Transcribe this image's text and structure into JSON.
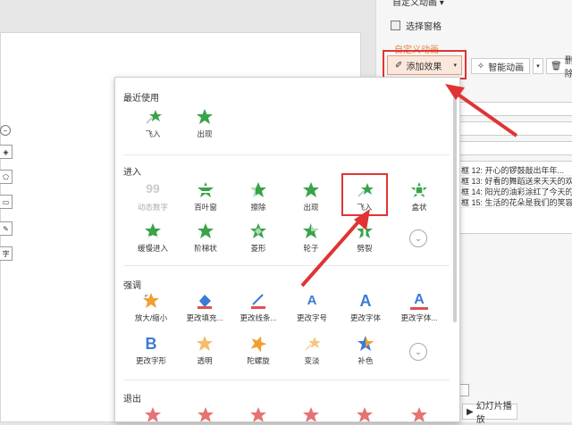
{
  "pane": {
    "title": "自定义动画",
    "selection_pane": "选择窗格",
    "custom_animation": "自定义动画",
    "add_effect": "添加效果",
    "smart_animation": "智能动画",
    "delete": "删除",
    "animation_list": [
      "框 12: 开心的锣鼓敲出年年...",
      "框 13: 好看的舞蹈送来天天的欢",
      "框 14: 阳光的油彩涂红了今天的",
      "框 15: 生活的花朵是我们的笑容"
    ],
    "slideshow": "幻灯片播放"
  },
  "left_toolbar": {
    "text_tool": "字"
  },
  "popup": {
    "recent": {
      "title": "最近使用",
      "items": [
        {
          "label": "飞入",
          "icon": "fly-in-star-icon"
        },
        {
          "label": "出现",
          "icon": "appear-star-icon"
        }
      ]
    },
    "entrance": {
      "title": "进入",
      "items": [
        {
          "label": "动态数字",
          "icon": "dynamic-number-icon",
          "glyph": "99"
        },
        {
          "label": "百叶窗",
          "icon": "blinds-star-icon"
        },
        {
          "label": "擦除",
          "icon": "wipe-star-icon"
        },
        {
          "label": "出现",
          "icon": "appear-star-icon"
        },
        {
          "label": "飞入",
          "icon": "fly-in-star-icon"
        },
        {
          "label": "盒状",
          "icon": "box-star-icon"
        },
        {
          "label": "缓慢进入",
          "icon": "crawl-in-star-icon"
        },
        {
          "label": "阶梯状",
          "icon": "stairs-star-icon"
        },
        {
          "label": "菱形",
          "icon": "diamond-star-icon"
        },
        {
          "label": "轮子",
          "icon": "wheel-star-icon"
        },
        {
          "label": "劈裂",
          "icon": "split-star-icon"
        }
      ]
    },
    "emphasis": {
      "title": "强调",
      "items": [
        {
          "label": "放大/缩小",
          "icon": "grow-shrink-star-icon"
        },
        {
          "label": "更改填充...",
          "icon": "change-fill-icon"
        },
        {
          "label": "更改线条...",
          "icon": "change-line-icon"
        },
        {
          "label": "更改字号",
          "icon": "change-font-size-icon",
          "glyph": "A"
        },
        {
          "label": "更改字体",
          "icon": "change-font-icon",
          "glyph": "A"
        },
        {
          "label": "更改字体...",
          "icon": "change-font-color-icon",
          "glyph": "A"
        },
        {
          "label": "更改字形",
          "icon": "change-font-style-icon",
          "glyph": "B"
        },
        {
          "label": "透明",
          "icon": "transparent-star-icon"
        },
        {
          "label": "陀螺旋",
          "icon": "spin-star-icon"
        },
        {
          "label": "变淡",
          "icon": "fade-star-icon"
        },
        {
          "label": "补色",
          "icon": "complementary-color-icon"
        }
      ]
    },
    "exit": {
      "title": "退出"
    }
  },
  "colors": {
    "green_star": "#3aa34a",
    "orange_star": "#f0a030",
    "red_star": "#e05050",
    "highlight_red": "#e03434",
    "accent_orange": "#e07b39",
    "blue_glyph": "#3b7bd4"
  }
}
